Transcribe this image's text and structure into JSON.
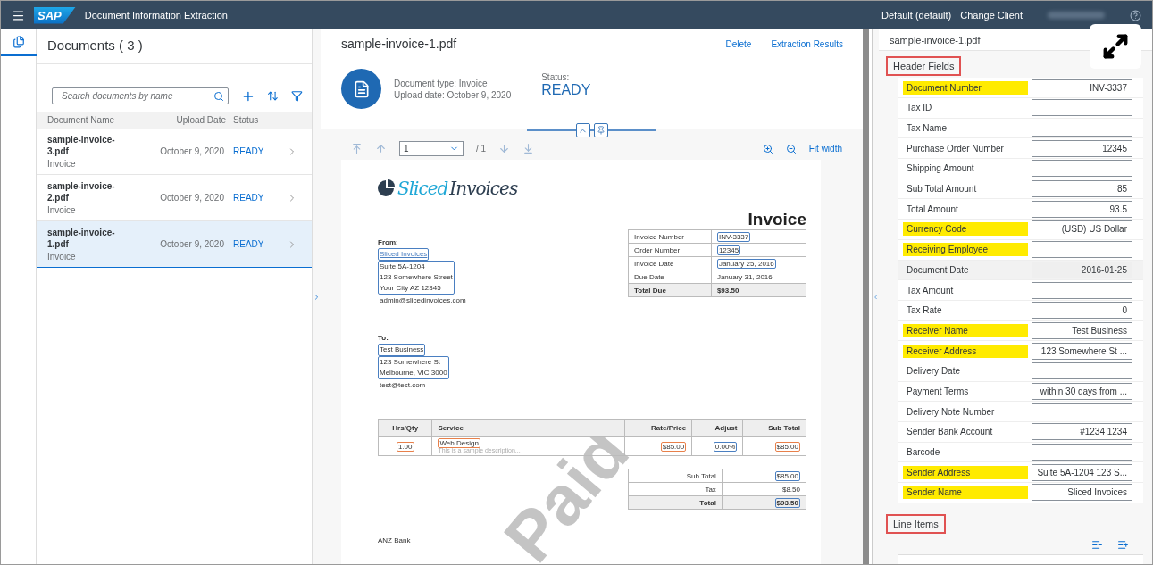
{
  "shell": {
    "logo": "SAP",
    "title": "Document Information Extraction",
    "tenant": "Default (default)",
    "change_client": "Change Client"
  },
  "documents": {
    "title": "Documents ( 3 )",
    "search_placeholder": "Search documents by name",
    "columns": [
      "Document Name",
      "Upload Date",
      "Status"
    ],
    "rows": [
      {
        "name": "sample-invoice-3.pdf",
        "type": "Invoice",
        "date": "October 9, 2020",
        "status": "READY",
        "selected": false
      },
      {
        "name": "sample-invoice-2.pdf",
        "type": "Invoice",
        "date": "October 9, 2020",
        "status": "READY",
        "selected": false
      },
      {
        "name": "sample-invoice-1.pdf",
        "type": "Invoice",
        "date": "October 9, 2020",
        "status": "READY",
        "selected": true
      }
    ]
  },
  "detail": {
    "title": "sample-invoice-1.pdf",
    "actions": [
      "Delete",
      "Extraction Results"
    ],
    "doc_type": "Document type: Invoice",
    "upload_date": "Upload date: October 9, 2020",
    "status_label": "Status:",
    "status": "READY",
    "toolbar": {
      "page": "1",
      "page_count": "/ 1",
      "fit": "Fit width"
    }
  },
  "invoice": {
    "logo_a": "Sliced",
    "logo_b": "Invoices",
    "heading": "Invoice",
    "watermark": "Paid",
    "from": {
      "label": "From:",
      "blocks": [
        {
          "lines": [
            "Sliced Invoices"
          ],
          "color": "#4a7fc1",
          "link": true
        },
        {
          "lines": [
            "Suite 5A-1204",
            "123 Somewhere Street",
            "Your City AZ 12345"
          ],
          "color": "#4a7fc1",
          "link": false
        },
        {
          "lines": [
            "admin@slicedinvoices.com"
          ],
          "link": false
        }
      ]
    },
    "to": {
      "label": "To:",
      "blocks": [
        {
          "lines": [
            "Test Business"
          ],
          "color": "#4a7fc1",
          "link": false
        },
        {
          "lines": [
            "123 Somewhere St",
            "Melbourne, VIC 3000"
          ],
          "color": "#4a7fc1",
          "link": false
        },
        {
          "lines": [
            "test@test.com"
          ],
          "link": false
        }
      ]
    },
    "meta": [
      {
        "label": "Invoice Number",
        "value": "INV-3337",
        "color": "#4a7fc1",
        "total": false
      },
      {
        "label": "Order Number",
        "value": "12345",
        "color": "#4a7fc1",
        "total": false
      },
      {
        "label": "Invoice Date",
        "value": "January 25, 2016",
        "color": "#4a7fc1",
        "total": false
      },
      {
        "label": "Due Date",
        "value": "January 31, 2016",
        "total": false
      },
      {
        "label": "Total Due",
        "value": "$93.50",
        "total": true
      }
    ],
    "item_columns": [
      "Hrs/Qty",
      "Service",
      "Rate/Price",
      "Adjust",
      "Sub Total"
    ],
    "items": [
      {
        "qty": {
          "text": "1.00",
          "color": "#e8804a"
        },
        "service": {
          "text": "Web Design",
          "color": "#e8804a"
        },
        "description": "This is a sample description...",
        "rate": {
          "text": "$85.00",
          "color": "#e8804a"
        },
        "adjust": {
          "text": "0.00%",
          "color": "#4a7fc1"
        },
        "subtotal": {
          "text": "$85.00",
          "color": "#e8804a"
        }
      }
    ],
    "totals": [
      {
        "label": "Sub Total",
        "value": "$85.00",
        "color": "#4a7fc1",
        "total": false
      },
      {
        "label": "Tax",
        "value": "$8.50",
        "total": false
      },
      {
        "label": "Total",
        "value": "$93.50",
        "color": "#4a7fc1",
        "total": true
      }
    ],
    "bank": "ANZ Bank"
  },
  "results": {
    "title": "sample-invoice-1.pdf",
    "sections": [
      {
        "title": "Header Fields",
        "outlined": true
      },
      {
        "title": "Line Items",
        "outlined": true
      }
    ],
    "fields": [
      {
        "label": "Document Number",
        "value": "INV-3337",
        "highlighted": true,
        "disabled": false
      },
      {
        "label": "Tax ID",
        "highlighted": false,
        "disabled": false
      },
      {
        "label": "Tax Name",
        "highlighted": false,
        "disabled": false
      },
      {
        "label": "Purchase Order Number",
        "value": "12345",
        "highlighted": false,
        "disabled": false
      },
      {
        "label": "Shipping Amount",
        "highlighted": false,
        "disabled": false
      },
      {
        "label": "Sub Total Amount",
        "value": "85",
        "highlighted": false,
        "disabled": false
      },
      {
        "label": "Total Amount",
        "value": "93.5",
        "highlighted": false,
        "disabled": false
      },
      {
        "label": "Currency Code",
        "value": "(USD) US Dollar",
        "highlighted": true,
        "disabled": false
      },
      {
        "label": "Receiving Employee",
        "highlighted": true,
        "disabled": false
      },
      {
        "label": "Document Date",
        "value": "2016-01-25",
        "highlighted": false,
        "disabled": true
      },
      {
        "label": "Tax Amount",
        "highlighted": false,
        "disabled": false
      },
      {
        "label": "Tax Rate",
        "value": "0",
        "highlighted": false,
        "disabled": false
      },
      {
        "label": "Receiver Name",
        "value": "Test Business",
        "highlighted": true,
        "disabled": false
      },
      {
        "label": "Receiver Address",
        "value": "123 Somewhere St ...",
        "highlighted": true,
        "disabled": false
      },
      {
        "label": "Delivery Date",
        "highlighted": false,
        "disabled": false
      },
      {
        "label": "Payment Terms",
        "value": "within 30 days from ...",
        "highlighted": false,
        "disabled": false
      },
      {
        "label": "Delivery Note Number",
        "highlighted": false,
        "disabled": false
      },
      {
        "label": "Sender Bank Account",
        "value": "#1234 1234",
        "highlighted": false,
        "disabled": false
      },
      {
        "label": "Barcode",
        "highlighted": false,
        "disabled": false
      },
      {
        "label": "Sender Address",
        "value": "Suite 5A-1204 123 S...",
        "highlighted": true,
        "disabled": false
      },
      {
        "label": "Sender Name",
        "value": "Sliced Invoices",
        "highlighted": true,
        "disabled": false
      }
    ]
  }
}
